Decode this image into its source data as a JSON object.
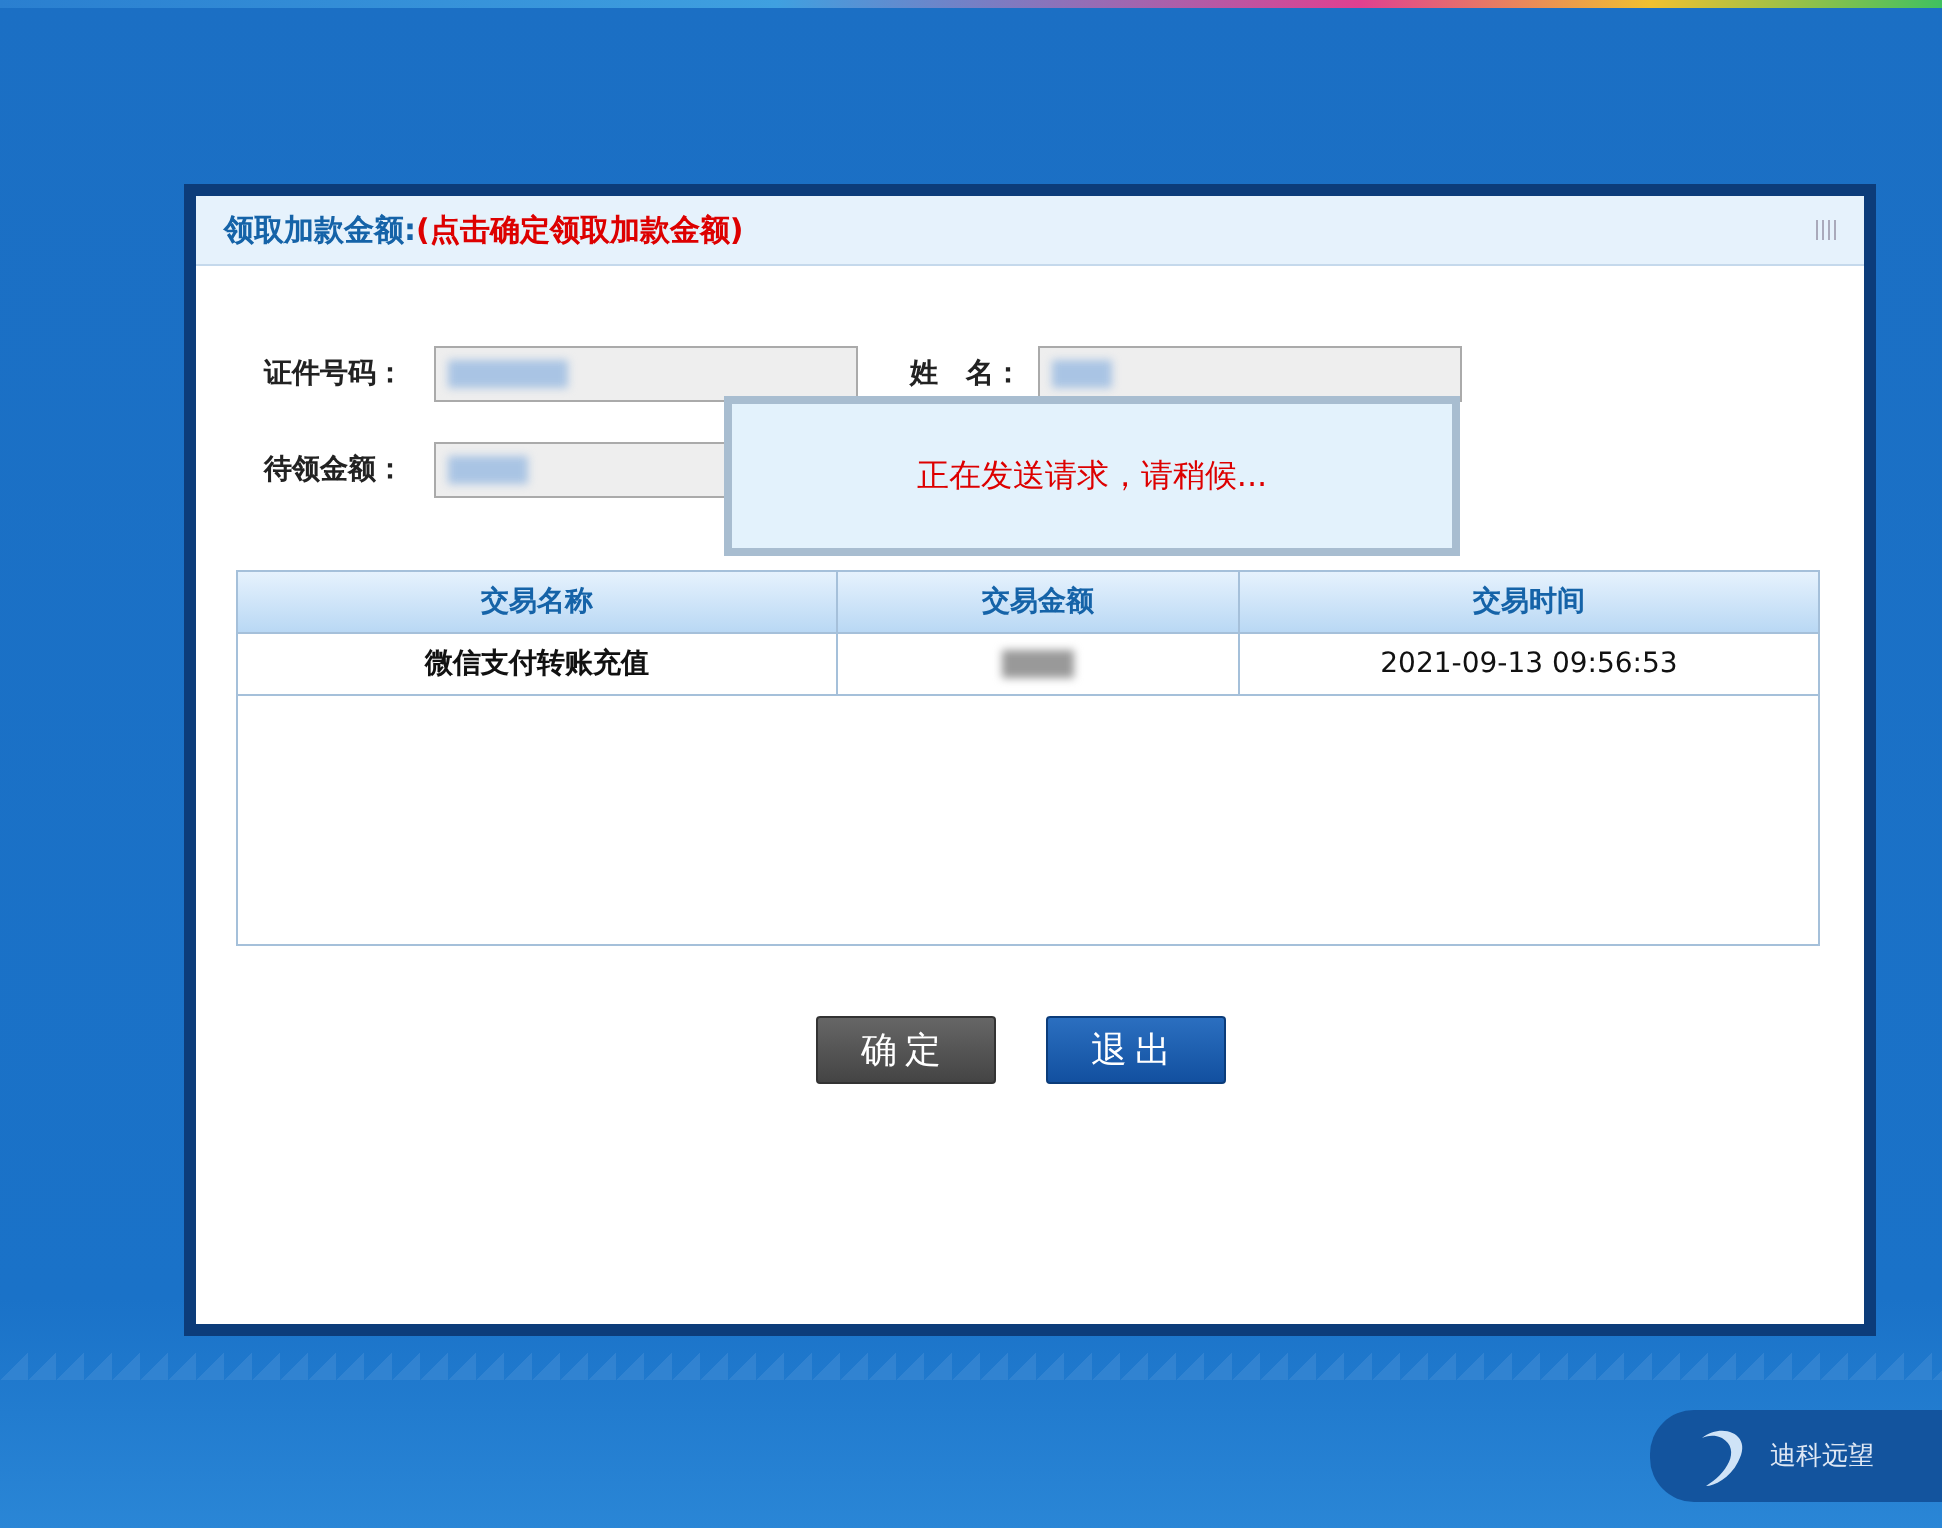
{
  "dialog": {
    "title": "领取加款金额:",
    "hint": "(点击确定领取加款金额)",
    "fields": [
      {
        "label": "证件号码："
      },
      {
        "label": "姓　名："
      },
      {
        "label": "待领金额："
      }
    ],
    "table": {
      "columns": [
        "交易名称",
        "交易金额",
        "交易时间"
      ],
      "rows": [
        {
          "name": "微信支付转账充值",
          "time": "2021-09-13 09:56:53"
        }
      ]
    },
    "buttons": [
      {
        "label": "确定",
        "kind": "dark"
      },
      {
        "label": "退出",
        "kind": "primary"
      }
    ]
  },
  "loading": {
    "message": "正在发送请求，请稍候..."
  },
  "logo": {
    "text": "迪科远望"
  }
}
